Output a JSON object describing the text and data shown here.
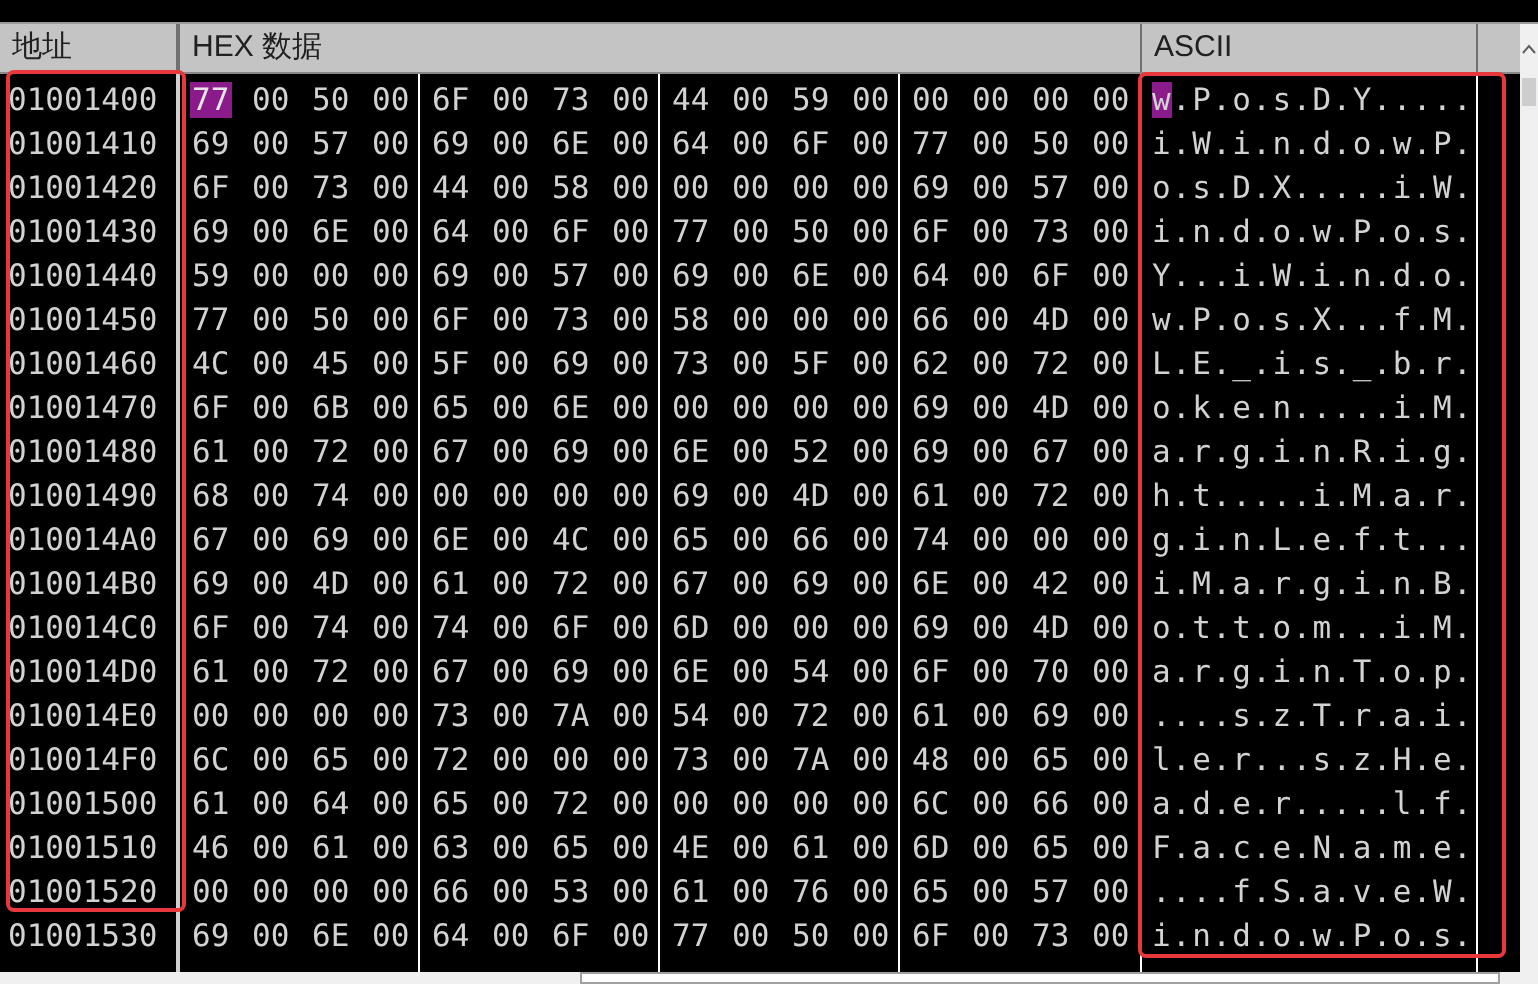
{
  "columns": {
    "address": "地址",
    "hex": "HEX  数据",
    "ascii": "ASCII"
  },
  "rows": [
    {
      "address": "01001400",
      "bytes": [
        "77",
        "00",
        "50",
        "00",
        "6F",
        "00",
        "73",
        "00",
        "44",
        "00",
        "59",
        "00",
        "00",
        "00",
        "00",
        "00"
      ],
      "ascii": "w.P.o.s.D.Y.....",
      "selected": true
    },
    {
      "address": "01001410",
      "bytes": [
        "69",
        "00",
        "57",
        "00",
        "69",
        "00",
        "6E",
        "00",
        "64",
        "00",
        "6F",
        "00",
        "77",
        "00",
        "50",
        "00"
      ],
      "ascii": "i.W.i.n.d.o.w.P.",
      "selected": false
    },
    {
      "address": "01001420",
      "bytes": [
        "6F",
        "00",
        "73",
        "00",
        "44",
        "00",
        "58",
        "00",
        "00",
        "00",
        "00",
        "00",
        "69",
        "00",
        "57",
        "00"
      ],
      "ascii": "o.s.D.X.....i.W.",
      "selected": false
    },
    {
      "address": "01001430",
      "bytes": [
        "69",
        "00",
        "6E",
        "00",
        "64",
        "00",
        "6F",
        "00",
        "77",
        "00",
        "50",
        "00",
        "6F",
        "00",
        "73",
        "00"
      ],
      "ascii": "i.n.d.o.w.P.o.s.",
      "selected": false
    },
    {
      "address": "01001440",
      "bytes": [
        "59",
        "00",
        "00",
        "00",
        "69",
        "00",
        "57",
        "00",
        "69",
        "00",
        "6E",
        "00",
        "64",
        "00",
        "6F",
        "00"
      ],
      "ascii": "Y...i.W.i.n.d.o.",
      "selected": false
    },
    {
      "address": "01001450",
      "bytes": [
        "77",
        "00",
        "50",
        "00",
        "6F",
        "00",
        "73",
        "00",
        "58",
        "00",
        "00",
        "00",
        "66",
        "00",
        "4D",
        "00"
      ],
      "ascii": "w.P.o.s.X...f.M.",
      "selected": false
    },
    {
      "address": "01001460",
      "bytes": [
        "4C",
        "00",
        "45",
        "00",
        "5F",
        "00",
        "69",
        "00",
        "73",
        "00",
        "5F",
        "00",
        "62",
        "00",
        "72",
        "00"
      ],
      "ascii": "L.E._.i.s._.b.r.",
      "selected": false
    },
    {
      "address": "01001470",
      "bytes": [
        "6F",
        "00",
        "6B",
        "00",
        "65",
        "00",
        "6E",
        "00",
        "00",
        "00",
        "00",
        "00",
        "69",
        "00",
        "4D",
        "00"
      ],
      "ascii": "o.k.e.n.....i.M.",
      "selected": false
    },
    {
      "address": "01001480",
      "bytes": [
        "61",
        "00",
        "72",
        "00",
        "67",
        "00",
        "69",
        "00",
        "6E",
        "00",
        "52",
        "00",
        "69",
        "00",
        "67",
        "00"
      ],
      "ascii": "a.r.g.i.n.R.i.g.",
      "selected": false
    },
    {
      "address": "01001490",
      "bytes": [
        "68",
        "00",
        "74",
        "00",
        "00",
        "00",
        "00",
        "00",
        "69",
        "00",
        "4D",
        "00",
        "61",
        "00",
        "72",
        "00"
      ],
      "ascii": "h.t.....i.M.a.r.",
      "selected": false
    },
    {
      "address": "010014A0",
      "bytes": [
        "67",
        "00",
        "69",
        "00",
        "6E",
        "00",
        "4C",
        "00",
        "65",
        "00",
        "66",
        "00",
        "74",
        "00",
        "00",
        "00"
      ],
      "ascii": "g.i.n.L.e.f.t...",
      "selected": false
    },
    {
      "address": "010014B0",
      "bytes": [
        "69",
        "00",
        "4D",
        "00",
        "61",
        "00",
        "72",
        "00",
        "67",
        "00",
        "69",
        "00",
        "6E",
        "00",
        "42",
        "00"
      ],
      "ascii": "i.M.a.r.g.i.n.B.",
      "selected": false
    },
    {
      "address": "010014C0",
      "bytes": [
        "6F",
        "00",
        "74",
        "00",
        "74",
        "00",
        "6F",
        "00",
        "6D",
        "00",
        "00",
        "00",
        "69",
        "00",
        "4D",
        "00"
      ],
      "ascii": "o.t.t.o.m...i.M.",
      "selected": false
    },
    {
      "address": "010014D0",
      "bytes": [
        "61",
        "00",
        "72",
        "00",
        "67",
        "00",
        "69",
        "00",
        "6E",
        "00",
        "54",
        "00",
        "6F",
        "00",
        "70",
        "00"
      ],
      "ascii": "a.r.g.i.n.T.o.p.",
      "selected": false
    },
    {
      "address": "010014E0",
      "bytes": [
        "00",
        "00",
        "00",
        "00",
        "73",
        "00",
        "7A",
        "00",
        "54",
        "00",
        "72",
        "00",
        "61",
        "00",
        "69",
        "00"
      ],
      "ascii": "....s.z.T.r.a.i.",
      "selected": false
    },
    {
      "address": "010014F0",
      "bytes": [
        "6C",
        "00",
        "65",
        "00",
        "72",
        "00",
        "00",
        "00",
        "73",
        "00",
        "7A",
        "00",
        "48",
        "00",
        "65",
        "00"
      ],
      "ascii": "l.e.r...s.z.H.e.",
      "selected": false
    },
    {
      "address": "01001500",
      "bytes": [
        "61",
        "00",
        "64",
        "00",
        "65",
        "00",
        "72",
        "00",
        "00",
        "00",
        "00",
        "00",
        "6C",
        "00",
        "66",
        "00"
      ],
      "ascii": "a.d.e.r.....l.f.",
      "selected": false
    },
    {
      "address": "01001510",
      "bytes": [
        "46",
        "00",
        "61",
        "00",
        "63",
        "00",
        "65",
        "00",
        "4E",
        "00",
        "61",
        "00",
        "6D",
        "00",
        "65",
        "00"
      ],
      "ascii": "F.a.c.e.N.a.m.e.",
      "selected": false
    },
    {
      "address": "01001520",
      "bytes": [
        "00",
        "00",
        "00",
        "00",
        "66",
        "00",
        "53",
        "00",
        "61",
        "00",
        "76",
        "00",
        "65",
        "00",
        "57",
        "00"
      ],
      "ascii": "....f.S.a.v.e.W.",
      "selected": false
    },
    {
      "address": "01001530",
      "bytes": [
        "69",
        "00",
        "6E",
        "00",
        "64",
        "00",
        "6F",
        "00",
        "77",
        "00",
        "50",
        "00",
        "6F",
        "00",
        "73",
        "00"
      ],
      "ascii": "i.n.d.o.w.P.o.s.",
      "selected": false
    }
  ]
}
